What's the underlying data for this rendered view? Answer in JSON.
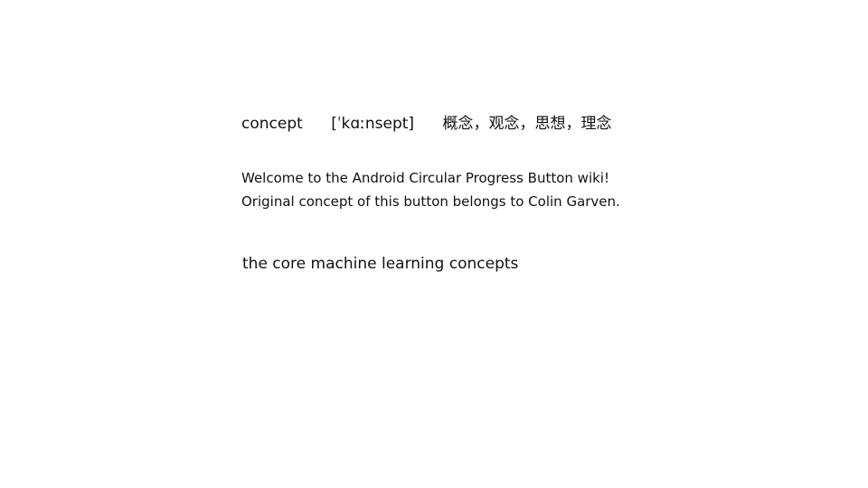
{
  "entry": {
    "word": "concept",
    "phonetic": "[ˈkɑːnsept]",
    "translation": "概念，观念，思想，理念"
  },
  "paragraph": {
    "line1": "Welcome to the Android Circular Progress Button wiki!",
    "line2": "Original concept of this button belongs to Colin Garven."
  },
  "phrase": {
    "text": "the core machine learning concepts"
  }
}
